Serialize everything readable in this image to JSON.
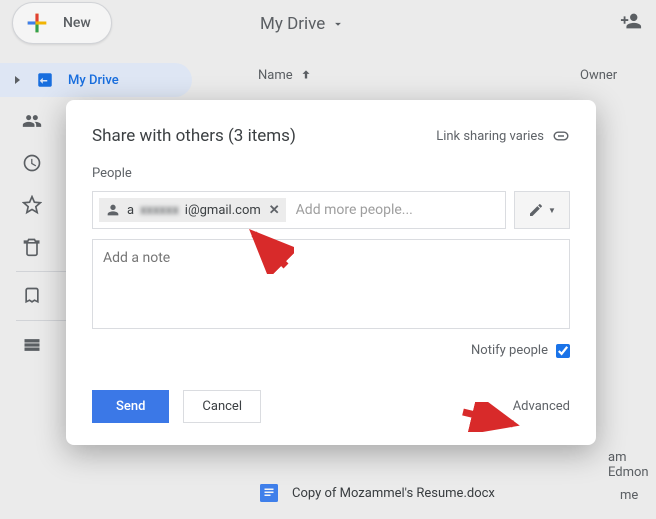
{
  "topbar": {
    "new_label": "New"
  },
  "header": {
    "drive_title": "My Drive"
  },
  "columns": {
    "name": "Name",
    "owner": "Owner"
  },
  "sidebar": {
    "mydrive": "My Drive"
  },
  "modal": {
    "title": "Share with others (3 items)",
    "link_sharing": "Link sharing varies",
    "people_label": "People",
    "chip_prefix": "a",
    "chip_suffix": "i@gmail.com",
    "add_more_placeholder": "Add more people...",
    "note_placeholder": "Add a note",
    "notify_label": "Notify people",
    "send": "Send",
    "cancel": "Cancel",
    "advanced": "Advanced"
  },
  "file_row": {
    "name": "Copy of Mozammel's Resume.docx",
    "owner": "me"
  },
  "edmon": "am Edmon"
}
